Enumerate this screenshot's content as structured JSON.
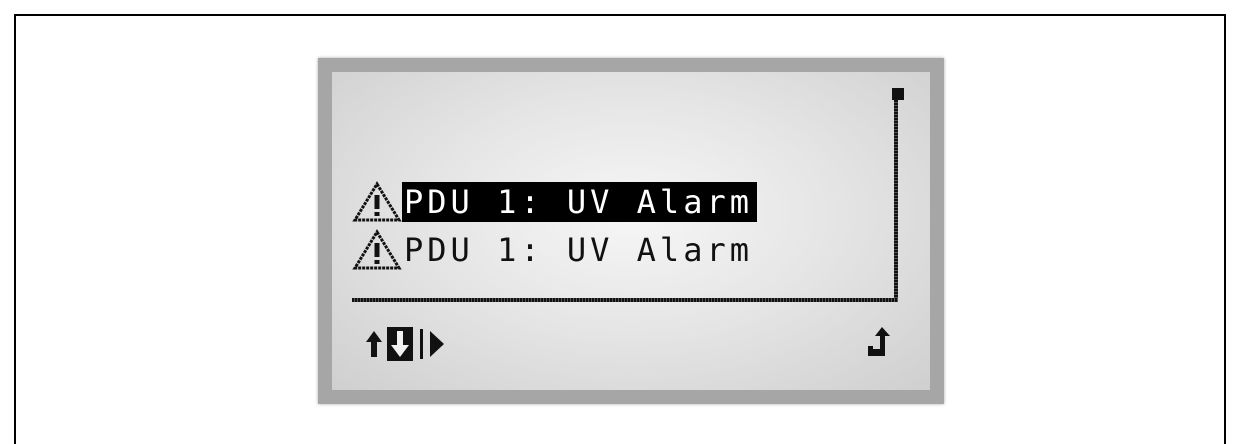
{
  "alarm_list": {
    "items": [
      {
        "label": "PDU 1: UV Alarm",
        "selected": true,
        "icon": "warning-icon"
      },
      {
        "label": "PDU 1: UV Alarm",
        "selected": false,
        "icon": "warning-icon"
      }
    ]
  },
  "navigation": {
    "icons": [
      "arrow-up-icon",
      "arrow-down-icon",
      "arrow-right-icon"
    ],
    "enter_icon": "enter-icon"
  },
  "colors": {
    "bezel": "#a6a6a6",
    "screen": "#e6e6e6",
    "pixel": "#111111"
  }
}
